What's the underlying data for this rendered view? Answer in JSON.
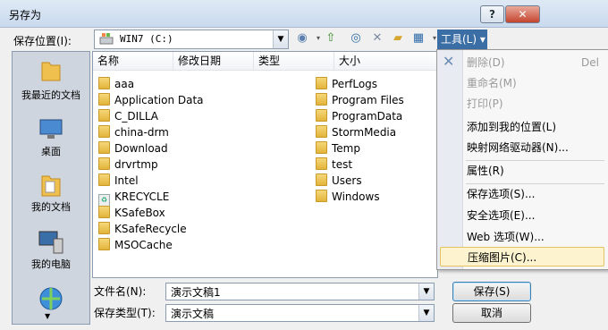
{
  "window": {
    "title": "另存为",
    "help": "?",
    "close": "✕"
  },
  "location": {
    "label": "保存位置(I):",
    "value": "WIN7 (C:)"
  },
  "toolbar": {
    "tools_label": "工具(L) ▾"
  },
  "places": [
    {
      "label": "我最近的文档",
      "icon": "recent-docs-icon"
    },
    {
      "label": "桌面",
      "icon": "desktop-icon"
    },
    {
      "label": "我的文档",
      "icon": "my-documents-icon"
    },
    {
      "label": "我的电脑",
      "icon": "my-computer-icon"
    }
  ],
  "columns": [
    "名称",
    "修改日期",
    "类型",
    "大小"
  ],
  "files_col1": [
    "aaa",
    "Application Data",
    "C_DILLA",
    "china-drm",
    "Download",
    "drvrtmp",
    "Intel",
    "KRECYCLE",
    "KSafeBox",
    "KSafeRecycle",
    "MSOCache"
  ],
  "files_col2": [
    "PerfLogs",
    "Program Files",
    "ProgramData",
    "StormMedia",
    "Temp",
    "test",
    "Users",
    "Windows"
  ],
  "filename": {
    "label": "文件名(N):",
    "value": "演示文稿1"
  },
  "filetype": {
    "label": "保存类型(T):",
    "value": "演示文稿"
  },
  "buttons": {
    "save": "保存(S)",
    "cancel": "取消"
  },
  "menu": {
    "delete": "删除(D)",
    "delete_shortcut": "Del",
    "rename": "重命名(M)",
    "print": "打印(P)",
    "add_places": "添加到我的位置(L)",
    "map_drive": "映射网络驱动器(N)...",
    "properties": "属性(R)",
    "save_options": "保存选项(S)...",
    "security": "安全选项(E)...",
    "web": "Web 选项(W)...",
    "compress": "压缩图片(C)..."
  },
  "colors": {
    "highlight": "#fdf3cf",
    "tools_active": "#3b6ea5",
    "folder": "#e3b33a"
  }
}
